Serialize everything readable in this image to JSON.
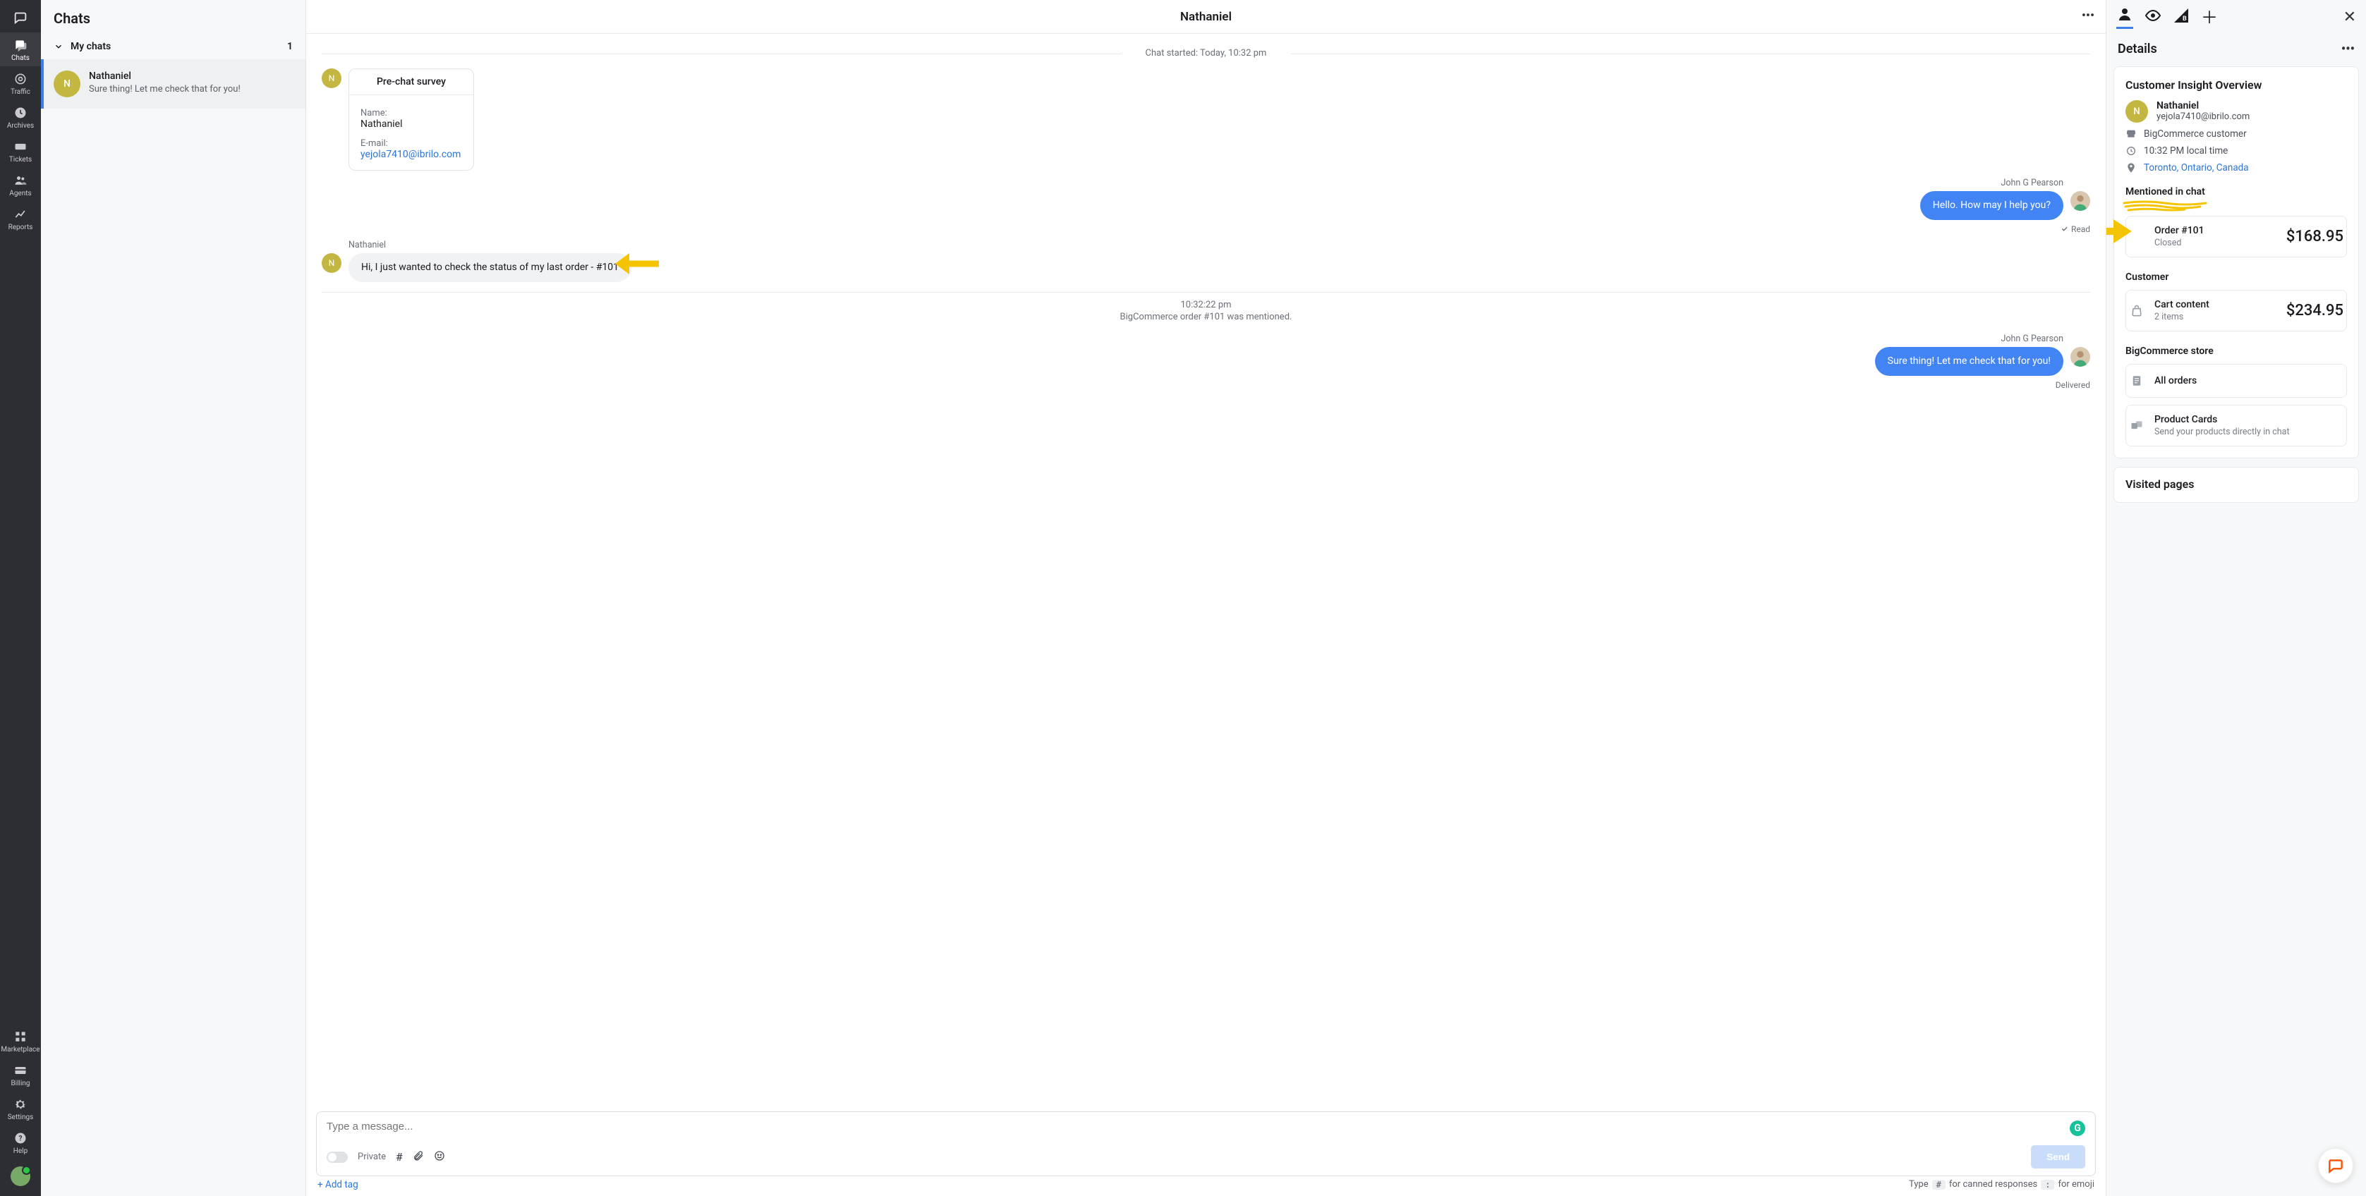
{
  "nav": {
    "items": [
      {
        "icon": "chats",
        "label": "Chats",
        "selected": true
      },
      {
        "icon": "traffic",
        "label": "Traffic"
      },
      {
        "icon": "archives",
        "label": "Archives"
      },
      {
        "icon": "tickets",
        "label": "Tickets"
      },
      {
        "icon": "agents",
        "label": "Agents"
      },
      {
        "icon": "reports",
        "label": "Reports"
      }
    ],
    "bottom": [
      {
        "icon": "marketplace",
        "label": "Marketplace"
      },
      {
        "icon": "billing",
        "label": "Billing"
      },
      {
        "icon": "settings",
        "label": "Settings"
      },
      {
        "icon": "help",
        "label": "Help"
      }
    ]
  },
  "chats_col": {
    "title": "Chats",
    "group_label": "My chats",
    "group_count": "1",
    "item": {
      "initial": "N",
      "name": "Nathaniel",
      "preview": "Sure thing! Let me check that for you!"
    }
  },
  "conv": {
    "title": "Nathaniel",
    "started": "Chat started: Today, 10:32 pm",
    "survey_title": "Pre-chat survey",
    "survey_name_label": "Name:",
    "survey_name": "Nathaniel",
    "survey_email_label": "E-mail:",
    "survey_email": "yejola7410@ibrilo.com",
    "agent_name": "John G Pearson",
    "agent_msg1": "Hello. How may I help you?",
    "read": "Read",
    "cust_name": "Nathaniel",
    "cust_msg": "Hi, I just wanted to check the status of my last order - #101",
    "sys_time": "10:32:22 pm",
    "sys_text": "BigCommerce order #101 was mentioned.",
    "agent_msg2": "Sure thing! Let me check that for you!",
    "delivered": "Delivered",
    "placeholder": "Type a message...",
    "private_label": "Private",
    "send_label": "Send",
    "addtag": "+ Add tag",
    "hint_prefix": "Type",
    "hint_key1": "#",
    "hint_mid": "for canned responses",
    "hint_key2": ":",
    "hint_suffix": "for emoji"
  },
  "right": {
    "details_title": "Details",
    "overview_title": "Customer Insight Overview",
    "cust_name": "Nathaniel",
    "cust_email": "yejola7410@ibrilo.com",
    "store_line": "BigCommerce customer",
    "time_line": "10:32 PM local time",
    "location": "Toronto, Ontario, Canada",
    "mentioned_label": "Mentioned in chat",
    "order_title": "Order #101",
    "order_status": "Closed",
    "order_total": "$168.95",
    "customer_label": "Customer",
    "cart_title": "Cart content",
    "cart_sub": "2 items",
    "cart_total": "$234.95",
    "store_label": "BigCommerce store",
    "allorders": "All orders",
    "prodcards": "Product Cards",
    "prodcards_sub": "Send your products directly in chat",
    "visited_label": "Visited pages"
  }
}
